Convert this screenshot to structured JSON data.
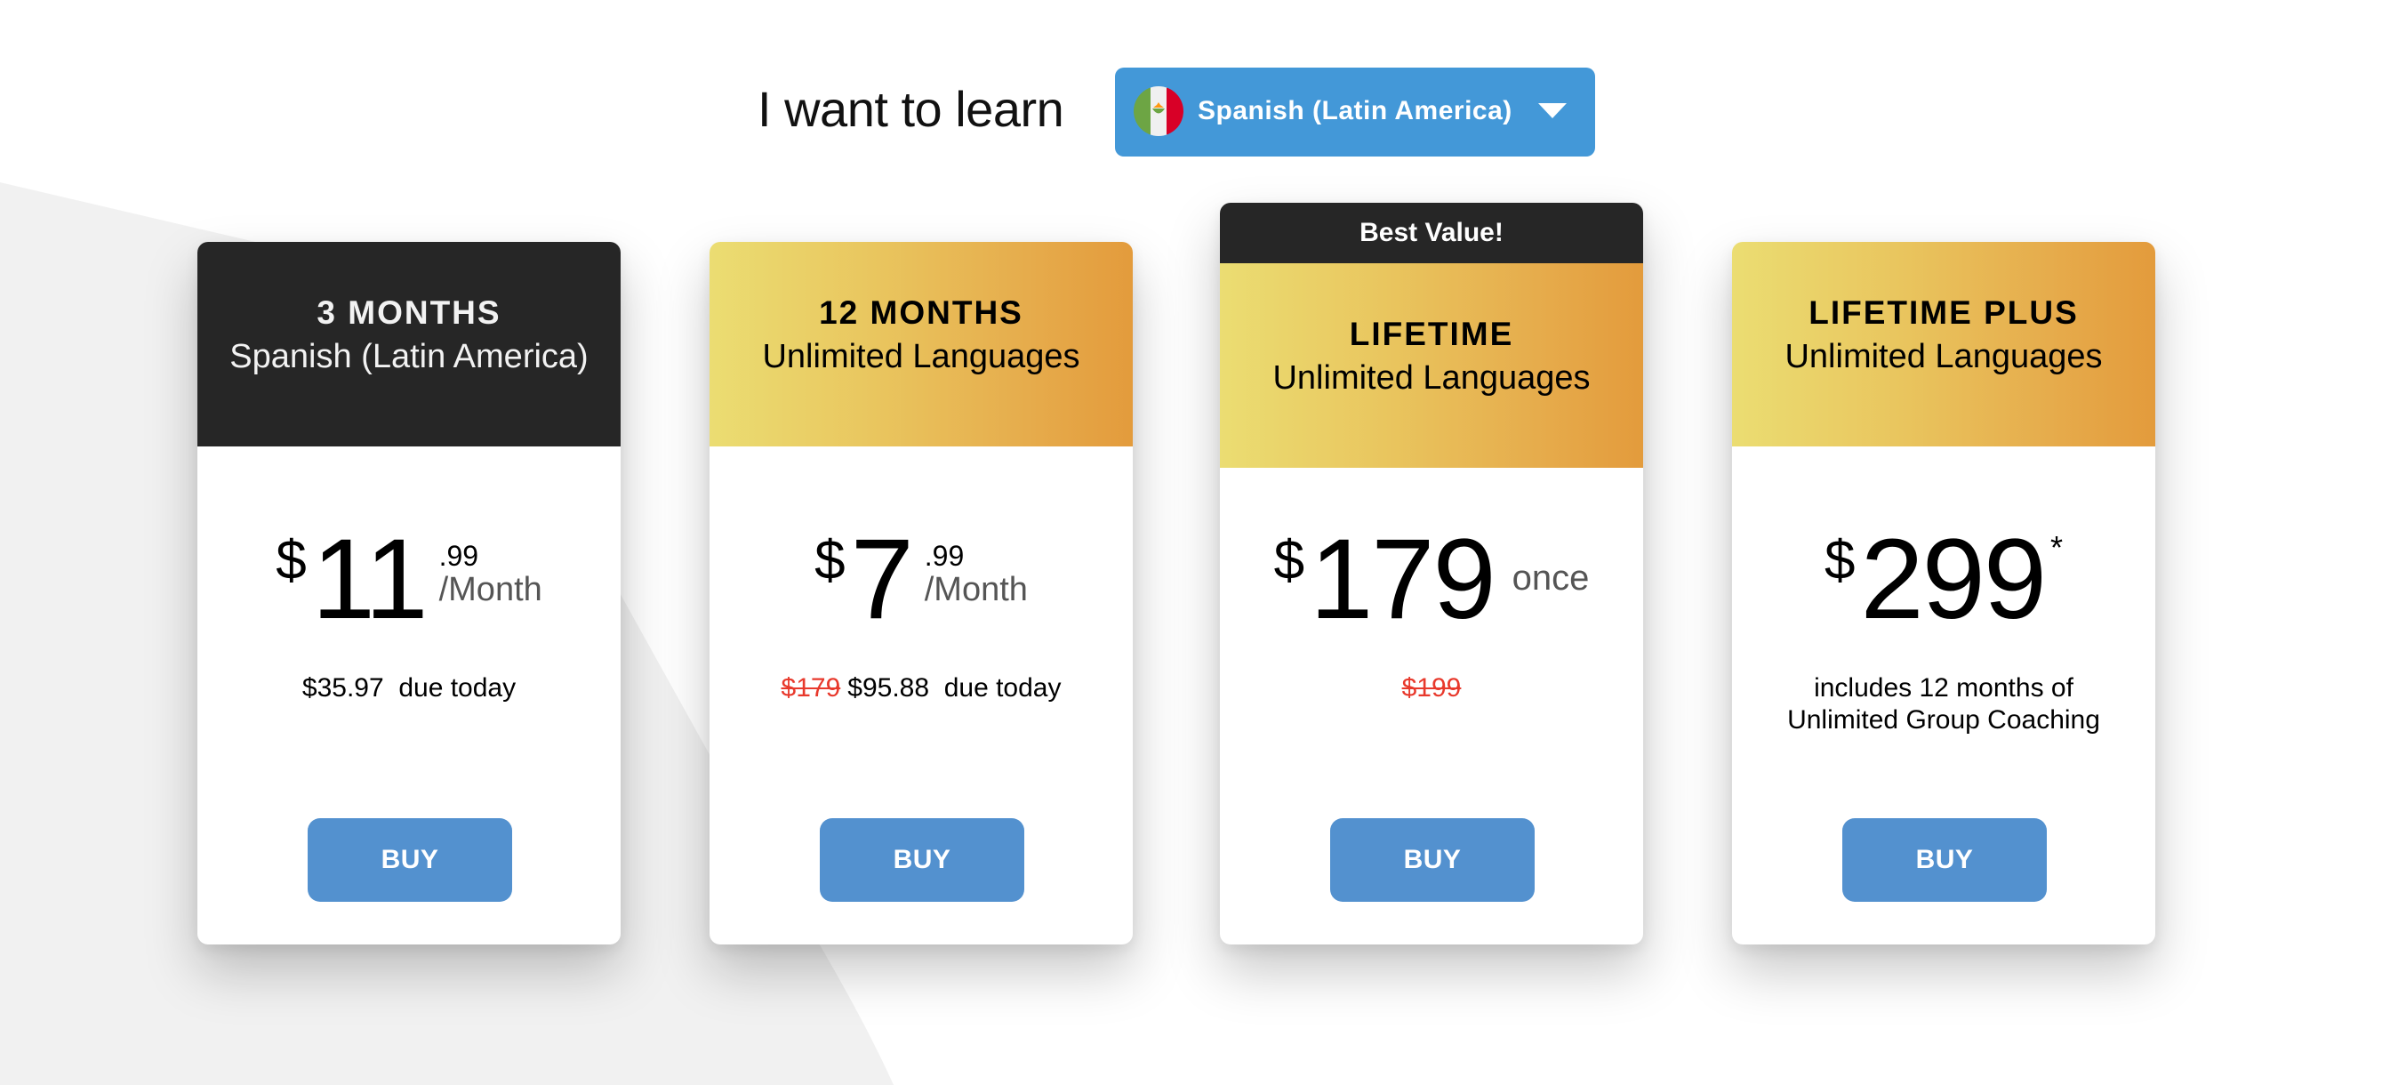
{
  "header": {
    "label": "I want to learn",
    "language_select": {
      "value": "Spanish (Latin America)",
      "flag_icon": "mexico-flag-icon",
      "caret_icon": "caret-down-icon"
    }
  },
  "colors": {
    "select_bg": "#4398d8",
    "buy_button": "#5391cf",
    "dark_header": "#262626",
    "gold_gradient_start": "#ebdd72",
    "gold_gradient_end": "#e39b3c",
    "strike_red": "#e8392c"
  },
  "plans": [
    {
      "title": "3 MONTHS",
      "subtitle": "Spanish (Latin America)",
      "currency": "$",
      "amount": "11",
      "cents": ".99",
      "period": "/Month",
      "note_strike": "",
      "note": "$35.97  due today",
      "buy_label": "BUY"
    },
    {
      "title": "12 MONTHS",
      "subtitle": "Unlimited Languages",
      "currency": "$",
      "amount": "7",
      "cents": ".99",
      "period": "/Month",
      "note_strike": "$179",
      "note": "$95.88  due today",
      "buy_label": "BUY"
    },
    {
      "badge": "Best Value!",
      "title": "LIFETIME",
      "subtitle": "Unlimited Languages",
      "currency": "$",
      "amount": "179",
      "suffix": "once",
      "note_strike": "$199",
      "buy_label": "BUY"
    },
    {
      "title": "LIFETIME PLUS",
      "subtitle": "Unlimited Languages",
      "currency": "$",
      "amount": "299",
      "asterisk": "*",
      "note_line1": "includes 12 months of",
      "note_line2": "Unlimited Group Coaching",
      "buy_label": "BUY"
    }
  ]
}
